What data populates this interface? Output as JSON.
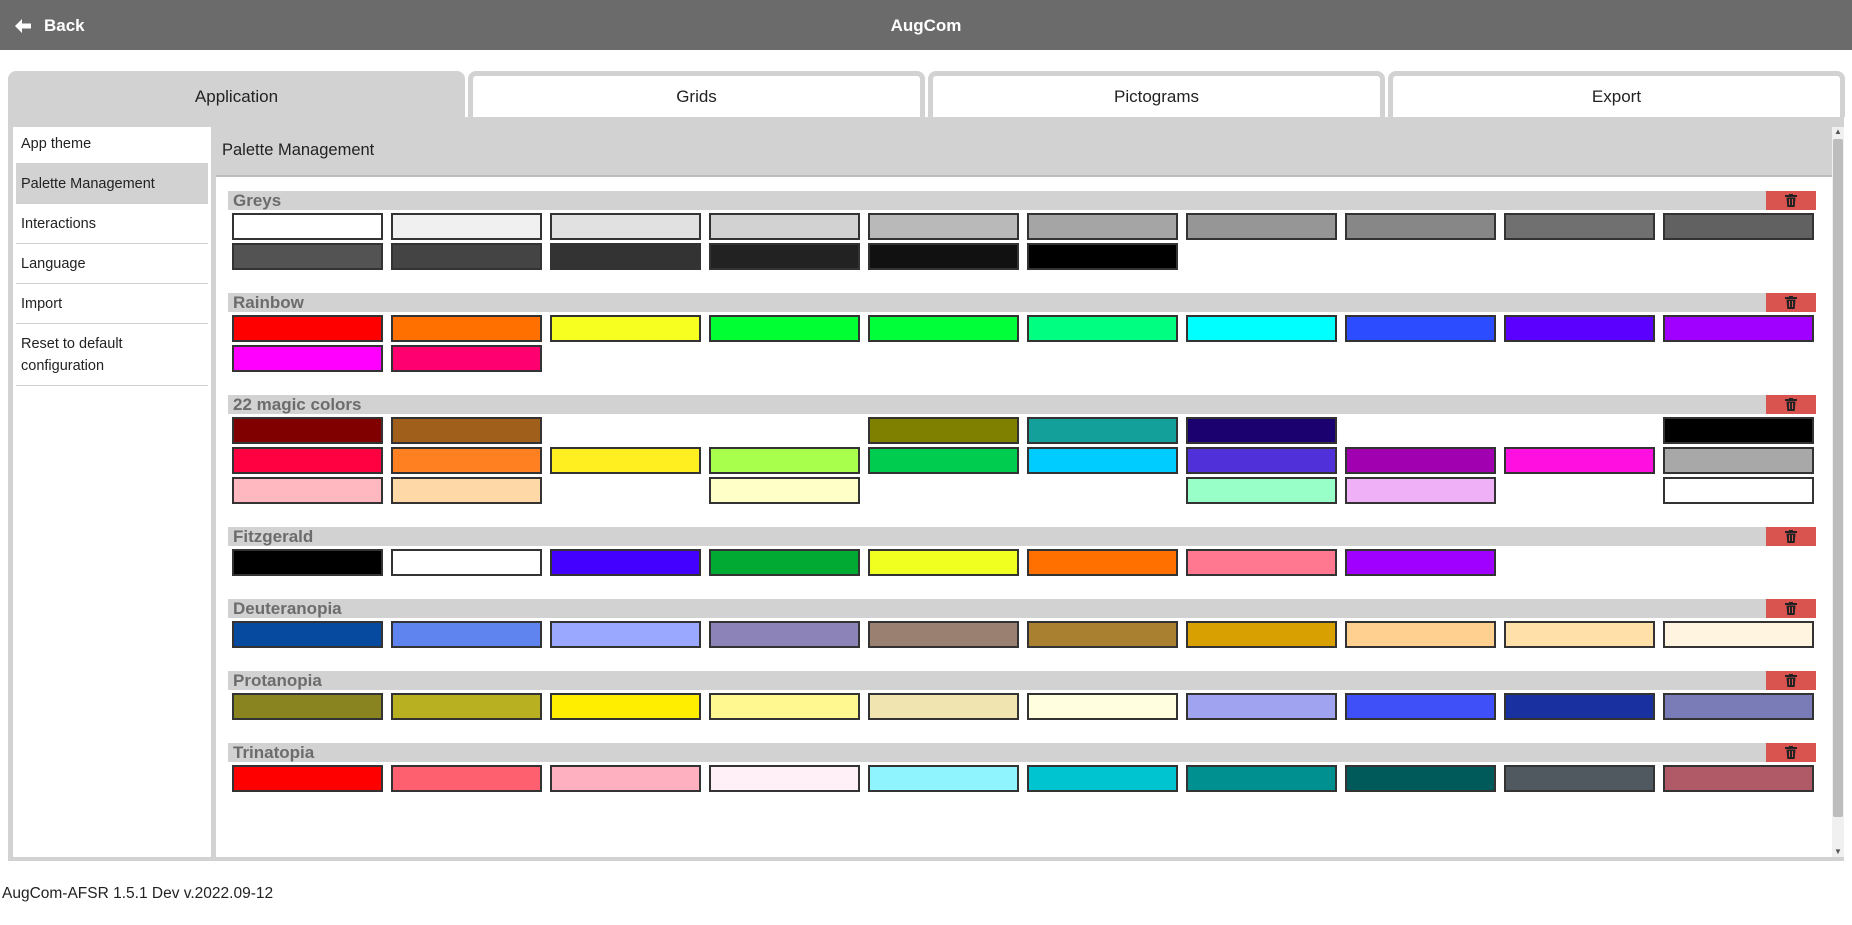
{
  "header": {
    "back_label": "Back",
    "title": "AugCom"
  },
  "tabs": [
    {
      "label": "Application",
      "active": true
    },
    {
      "label": "Grids",
      "active": false
    },
    {
      "label": "Pictograms",
      "active": false
    },
    {
      "label": "Export",
      "active": false
    }
  ],
  "sidebar": {
    "items": [
      {
        "label": "App theme",
        "active": false
      },
      {
        "label": "Palette Management",
        "active": true
      },
      {
        "label": "Interactions",
        "active": false
      },
      {
        "label": "Language",
        "active": false
      },
      {
        "label": "Import",
        "active": false
      },
      {
        "label": "Reset to default configuration",
        "active": false
      }
    ]
  },
  "content": {
    "title": "Palette Management"
  },
  "palettes": [
    {
      "name": "Greys",
      "colors": [
        "#ffffff",
        "#f0f0f0",
        "#e1e1e1",
        "#d2d2d2",
        "#b9b9b9",
        "#a5a5a5",
        "#969696",
        "#878787",
        "#707070",
        "#616161",
        "#535353",
        "#444444",
        "#333333",
        "#222222",
        "#111111",
        "#000000"
      ]
    },
    {
      "name": "Rainbow",
      "colors": [
        "#ff0000",
        "#ff7000",
        "#f7ff20",
        "#00ff33",
        "#00ff39",
        "#00ff80",
        "#00ffff",
        "#2b4cff",
        "#5b00ff",
        "#a000ff",
        "#ff00ff",
        "#ff0070"
      ]
    },
    {
      "name": "22 magic colors",
      "colors": [
        "#800000",
        "#a0601c",
        null,
        null,
        "#808000",
        "#13a09a",
        "#1b0070",
        null,
        null,
        "#000000",
        "#ff0040",
        "#ff8020",
        "#ffef20",
        "#a8ff4c",
        "#00cc50",
        "#00ccff",
        "#5030d8",
        "#a000b0",
        "#ff10e0",
        "#a8a8a8",
        "#ffb8c0",
        "#ffd8a8",
        null,
        "#ffffc8",
        null,
        null,
        "#98ffc8",
        "#f0b0f8",
        null,
        "#ffffff"
      ]
    },
    {
      "name": "Fitzgerald",
      "colors": [
        "#000000",
        "#ffffff",
        "#4400ff",
        "#00aa33",
        "#f0ff20",
        "#ff7000",
        "#ff7890",
        "#a000ff"
      ]
    },
    {
      "name": "Deuteranopia",
      "colors": [
        "#064aa0",
        "#5f84f0",
        "#9aa8ff",
        "#8c84b8",
        "#9a8070",
        "#a88030",
        "#d8a000",
        "#ffd090",
        "#ffe0a8",
        "#fff4e0"
      ]
    },
    {
      "name": "Protanopia",
      "colors": [
        "#8a8420",
        "#b8b020",
        "#ffee00",
        "#fff890",
        "#f0e4b0",
        "#ffffe0",
        "#a0a4f0",
        "#4050f8",
        "#1830a0",
        "#7a7cb8"
      ]
    },
    {
      "name": "Trinatopia",
      "colors": [
        "#ff0000",
        "#ff6070",
        "#ffb0c0",
        "#fff0f8",
        "#90f4ff",
        "#00c4d0",
        "#009090",
        "#005a5a",
        "#505860",
        "#b05a68"
      ]
    }
  ],
  "footer": {
    "version": "AugCom-AFSR 1.5.1 Dev v.2022.09-12"
  }
}
